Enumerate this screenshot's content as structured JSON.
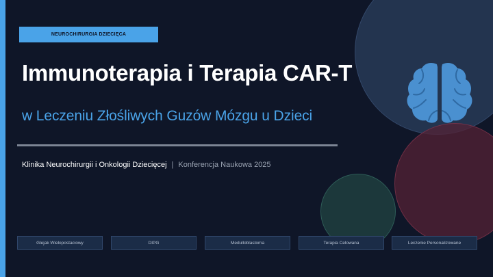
{
  "slide": {
    "category_label": "NEUROCHIRURGIA DZIECIĘCA",
    "title": "Immunoterapia i Terapia CAR-T",
    "subtitle": "w Leczeniu Złośliwych Guzów Mózgu u Dzieci",
    "institution": "Klinika Neurochirurgii i Onkologii Dziecięcej",
    "separator": "|",
    "conference": "Konferencja Naukowa 2025",
    "tags": [
      "Glejak Wielopostaciowy",
      "DIPG",
      "Medulloblastoma",
      "Terapia Celowana",
      "Leczenie Personalizowane"
    ]
  },
  "colors": {
    "background": "#0f1628",
    "accent": "#4aa3e8",
    "title": "#ffffff",
    "muted": "#9aa3b2"
  },
  "icons": {
    "main": "brain-icon"
  }
}
